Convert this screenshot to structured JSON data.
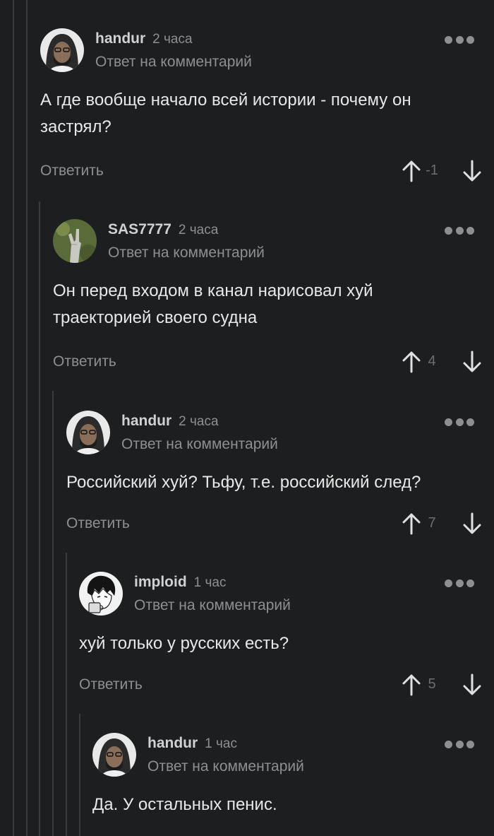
{
  "comments": [
    {
      "author": "handur",
      "time": "2 часа",
      "reply_label": "Ответ на комментарий",
      "text": "А где вообще начало всей истории - почему он застрял?",
      "reply_button": "Ответить",
      "score": "-1",
      "avatar": "hooded-man-avatar"
    },
    {
      "author": "SAS7777",
      "time": "2 часа",
      "reply_label": "Ответ на комментарий",
      "text": "Он перед входом в канал нарисовал хуй траекторией своего судна",
      "reply_button": "Ответить",
      "score": "4",
      "avatar": "rock-hand-statue-avatar"
    },
    {
      "author": "handur",
      "time": "2 часа",
      "reply_label": "Ответ на комментарий",
      "text": "Российский хуй? Тьфу, т.е. российский след?",
      "reply_button": "Ответить",
      "score": "7",
      "avatar": "hooded-man-avatar"
    },
    {
      "author": "imploid",
      "time": "1 час",
      "reply_label": "Ответ на комментарий",
      "text": "хуй только у русских есть?",
      "reply_button": "Ответить",
      "score": "5",
      "avatar": "manga-character-avatar"
    },
    {
      "author": "handur",
      "time": "1 час",
      "reply_label": "Ответ на комментарий",
      "text": "Да. У остальных пенис.",
      "avatar": "hooded-man-avatar"
    }
  ],
  "icons": {
    "more": "more-dots-icon",
    "up": "arrow-up-icon",
    "down": "arrow-down-icon"
  },
  "colors": {
    "background": "#1d1e20",
    "thread_line": "#3a3b3e",
    "muted_text": "#8d8f93",
    "body_text": "#e8e8e8"
  }
}
